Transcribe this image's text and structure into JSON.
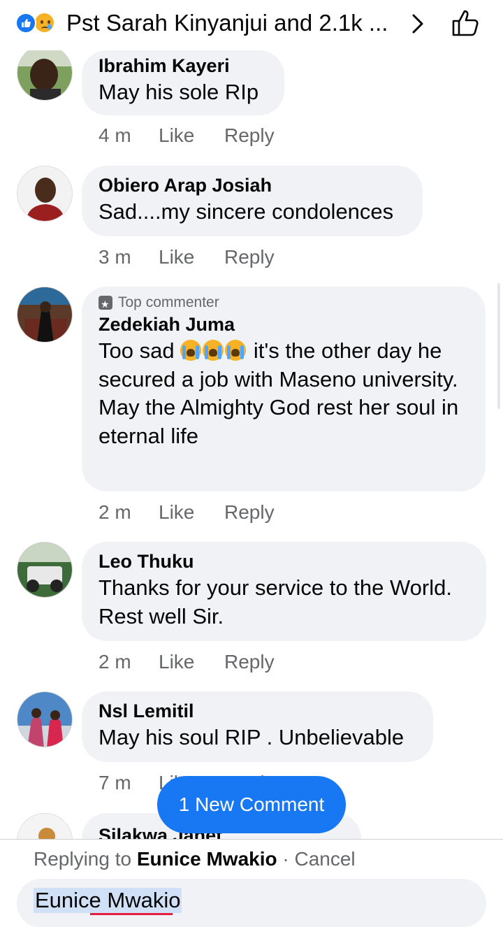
{
  "header": {
    "title": "Pst Sarah Kinyanjui and 2.1k ...",
    "reaction_icons": [
      "like-icon",
      "sad-icon"
    ],
    "next_icon": "chevron-right-icon",
    "like_icon": "thumbs-up-icon"
  },
  "comments": [
    {
      "name": "Ibrahim Kayeri",
      "text": "May his sole RIp",
      "time": "4 m",
      "like": "Like",
      "reply": "Reply"
    },
    {
      "name": "Obiero Arap Josiah",
      "text": "Sad....my sincere condolences",
      "time": "3 m",
      "like": "Like",
      "reply": "Reply"
    },
    {
      "name": "Zedekiah Juma",
      "badge": "Top commenter",
      "text_a": "Too sad",
      "text_b": " it's the other day he secured a job with Maseno university.",
      "text_c": "May the Almighty God rest her soul in eternal life",
      "time": "2 m",
      "like": "Like",
      "reply": "Reply"
    },
    {
      "name": "Leo Thuku",
      "text": "Thanks for your service to the World. Rest well Sir.",
      "time": "2 m",
      "like": "Like",
      "reply": "Reply"
    },
    {
      "name": "Nsl Lemitil",
      "text": "May his soul RIP . Unbelievable",
      "time": "7 m",
      "like": "Like",
      "reply": "Reply"
    },
    {
      "name": "Silakwa Janet"
    }
  ],
  "new_comment_pill": "1 New Comment",
  "footer": {
    "replying_prefix": "Replying to ",
    "replying_name": "Eunice Mwakio",
    "separator": " · ",
    "cancel": "Cancel",
    "input_value": "Eunice Mwakio"
  },
  "colors": {
    "accent": "#1877f2",
    "bubble": "#f0f2f5",
    "meta": "#65676b"
  }
}
